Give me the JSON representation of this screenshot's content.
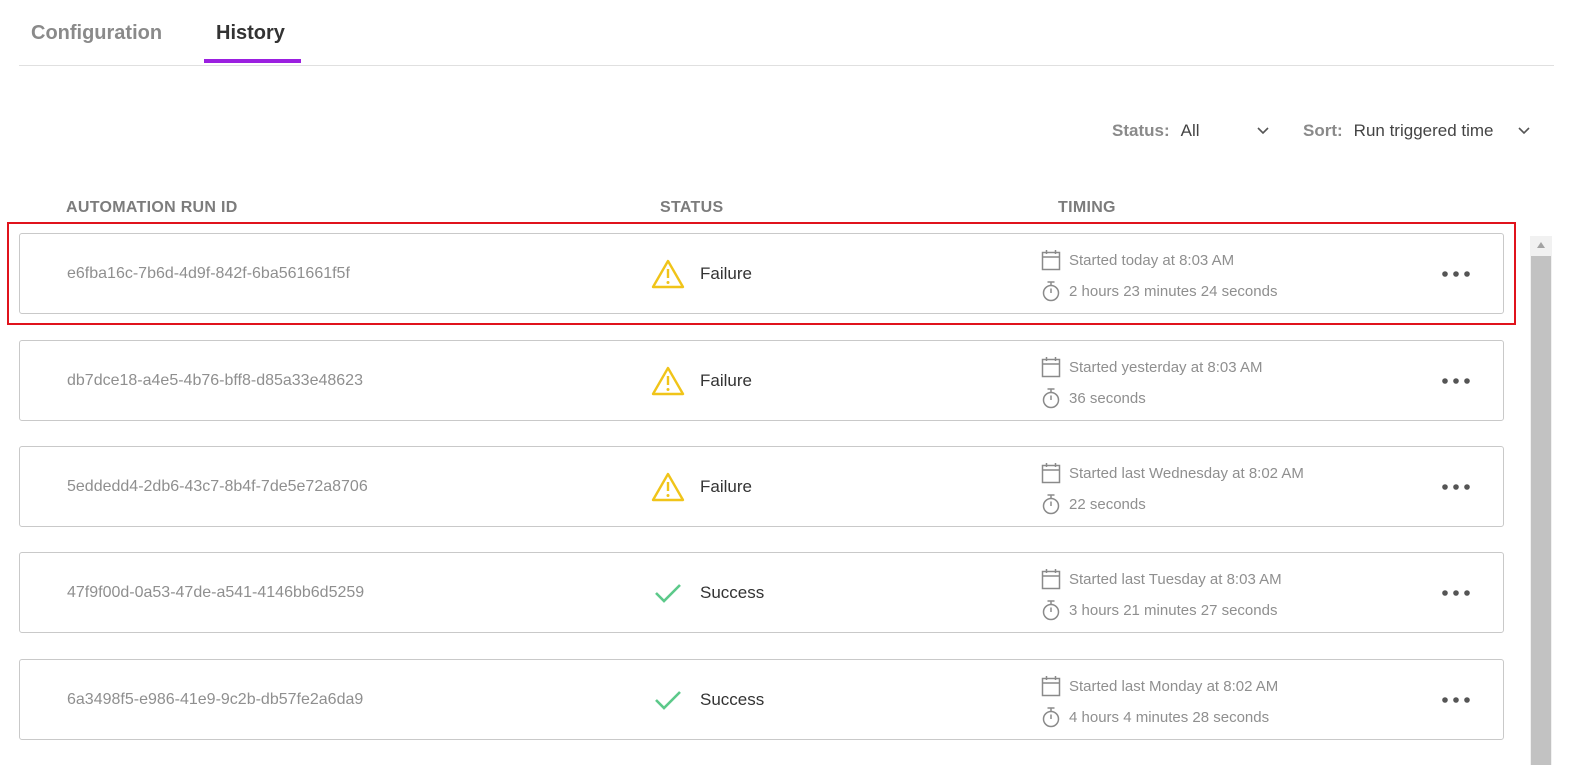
{
  "tabs": [
    {
      "label": "Configuration",
      "active": false
    },
    {
      "label": "History",
      "active": true
    }
  ],
  "colors": {
    "accent": "#9b1fe0",
    "failure_icon": "#f0c419",
    "success_icon": "#5cc98a",
    "selection": "#e0131c"
  },
  "filters": {
    "status_label": "Status:",
    "status_value": "All",
    "sort_label": "Sort:",
    "sort_value": "Run triggered time"
  },
  "columns": {
    "run_id": "AUTOMATION RUN ID",
    "status": "STATUS",
    "timing": "TIMING"
  },
  "runs": [
    {
      "id": "e6fba16c-7b6d-4d9f-842f-6ba561661f5f",
      "status": "Failure",
      "status_icon": "warning-icon",
      "started": "Started today at 8:03 AM",
      "duration": "2 hours 23 minutes 24 seconds",
      "selected": true
    },
    {
      "id": "db7dce18-a4e5-4b76-bff8-d85a33e48623",
      "status": "Failure",
      "status_icon": "warning-icon",
      "started": "Started yesterday at 8:03 AM",
      "duration": "36 seconds"
    },
    {
      "id": "5eddedd4-2db6-43c7-8b4f-7de5e72a8706",
      "status": "Failure",
      "status_icon": "warning-icon",
      "started": "Started last Wednesday at 8:02 AM",
      "duration": "22 seconds"
    },
    {
      "id": "47f9f00d-0a53-47de-a541-4146bb6d5259",
      "status": "Success",
      "status_icon": "checkmark-icon",
      "started": "Started last Tuesday at 8:03 AM",
      "duration": "3 hours 21 minutes 27 seconds"
    },
    {
      "id": "6a3498f5-e986-41e9-9c2b-db57fe2a6da9",
      "status": "Success",
      "status_icon": "checkmark-icon",
      "started": "Started last Monday at 8:02 AM",
      "duration": "4 hours 4 minutes 28 seconds"
    }
  ],
  "icons": {
    "calendar": "calendar-icon",
    "timer": "stopwatch-icon",
    "more": "more-options-icon",
    "chevron": "chevron-down-icon"
  }
}
